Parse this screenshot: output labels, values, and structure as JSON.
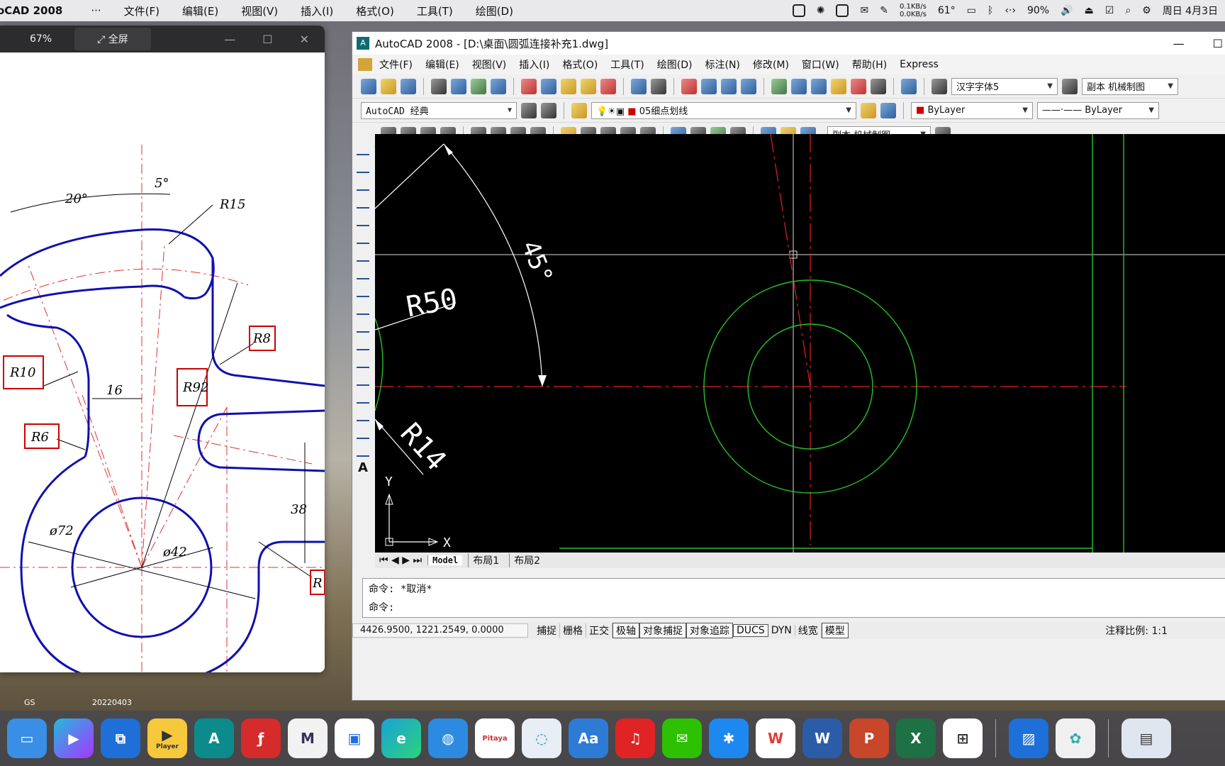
{
  "menubar": {
    "app": "oCAD 2008",
    "more": "···",
    "items": [
      "文件(F)",
      "编辑(E)",
      "视图(V)",
      "插入(I)",
      "格式(O)",
      "工具(T)",
      "绘图(D)"
    ],
    "net_up": "0.1KB/s",
    "net_down": "0.0KB/s",
    "temp": "61°",
    "battery": "90%",
    "date": "周日 4月3日"
  },
  "viewer": {
    "zoom": "67%",
    "fullscreen": "全屏",
    "drawing": {
      "dims": {
        "a20": "20°",
        "a5": "5°",
        "r15": "R15",
        "r8": "R8",
        "r10": "R10",
        "r92": "R92",
        "d16": "16",
        "r6": "R6",
        "d38": "38",
        "dia72": "ø72",
        "dia42": "ø42",
        "r_cut": "R"
      }
    }
  },
  "acad": {
    "title": "AutoCAD 2008 - [D:\\桌面\\圆弧连接补充1.dwg]",
    "menu": [
      "文件(F)",
      "编辑(E)",
      "视图(V)",
      "插入(I)",
      "格式(O)",
      "工具(T)",
      "绘图(D)",
      "标注(N)",
      "修改(M)",
      "窗口(W)",
      "帮助(H)",
      "Express"
    ],
    "font_combo": "汉字字体5",
    "dimstyle_combo": "副本 机械制图",
    "workspace_combo": "AutoCAD 经典",
    "layer_combo": "05细点划线",
    "color_combo": "ByLayer",
    "linetype_combo": "ByLayer",
    "dimstyle_combo2": "副本 机械制图",
    "canvas": {
      "angle_label": "45°",
      "r50": "R50",
      "r14": "R14",
      "ucs_x": "X",
      "ucs_y": "Y"
    },
    "tabs": [
      "Model",
      "布局1",
      "布局2"
    ],
    "cmd_line1": "命令: *取消*",
    "cmd_line2": "命令:",
    "coords": "4426.9500, 1221.2549, 0.0000",
    "status_buttons": [
      "捕捉",
      "栅格",
      "正交",
      "极轴",
      "对象捕捉",
      "对象追踪",
      "DUCS",
      "DYN",
      "线宽",
      "模型"
    ],
    "scale_label": "注释比例: 1:1"
  },
  "desktop": {
    "label1": "GS",
    "label2": "20220403"
  },
  "dock": {
    "apps": [
      {
        "name": "Finder",
        "color": "#3a8ee6"
      },
      {
        "name": "Player",
        "color": "#f5c518"
      },
      {
        "name": "Remote",
        "color": "#1e6fd8"
      },
      {
        "name": "Player",
        "color": "#f6c83c"
      },
      {
        "name": "AutoCAD",
        "color": "#0b8b8b"
      },
      {
        "name": "Flash",
        "color": "#d62b2b"
      },
      {
        "name": "M",
        "color": "#f2f2f2"
      },
      {
        "name": "Window",
        "color": "#ffffff"
      },
      {
        "name": "Edge",
        "color": "#1aa0d8"
      },
      {
        "name": "Globe",
        "color": "#2c8be0"
      },
      {
        "name": "Pitaya",
        "color": "#ffffff"
      },
      {
        "name": "Ring",
        "color": "#e8eef5"
      },
      {
        "name": "Aa",
        "color": "#2e7bd6"
      },
      {
        "name": "Music",
        "color": "#e02424"
      },
      {
        "name": "WeChat",
        "color": "#2dc100"
      },
      {
        "name": "Star",
        "color": "#1d88f0"
      },
      {
        "name": "WPS",
        "color": "#e53935"
      },
      {
        "name": "W",
        "color": "#2b5ca8"
      },
      {
        "name": "P",
        "color": "#c8462a"
      },
      {
        "name": "X",
        "color": "#1e7145"
      },
      {
        "name": "Win",
        "color": "#ffffff"
      },
      {
        "name": "Preview",
        "color": "#1e6fd8"
      },
      {
        "name": "ChatGPT",
        "color": "#f0f0f0"
      },
      {
        "name": "Thumb",
        "color": "#dfe6ef"
      }
    ],
    "player_label": "Player",
    "pitaya_label": "Pitaya"
  }
}
